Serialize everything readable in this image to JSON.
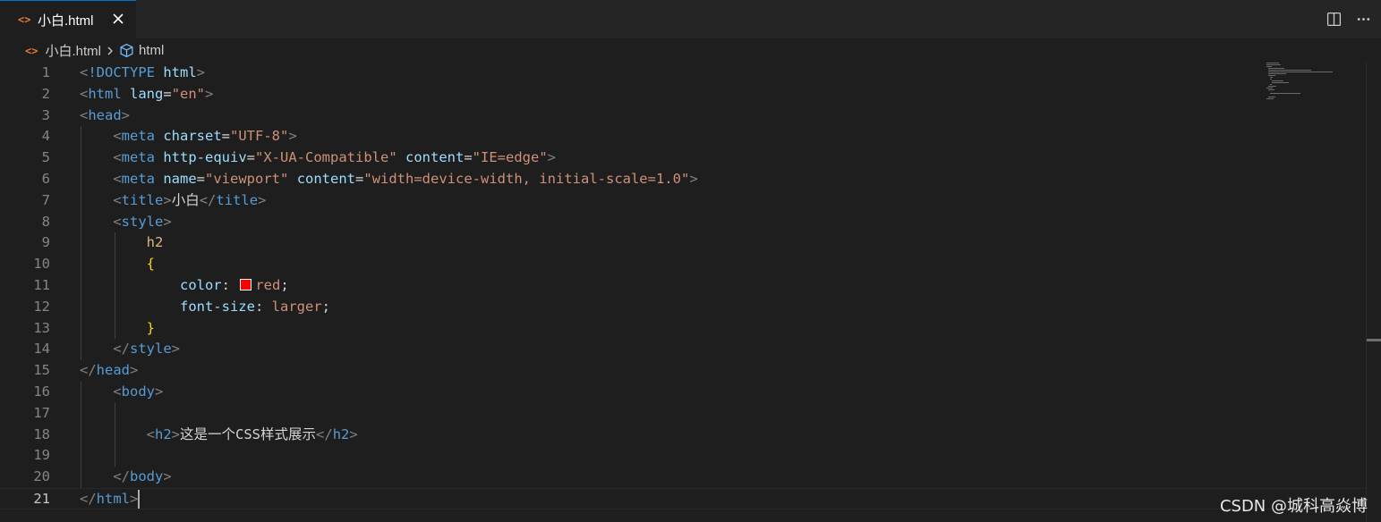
{
  "tab": {
    "label": "小白.html",
    "icon": "html-icon"
  },
  "breadcrumb": {
    "file": "小白.html",
    "symbol": "html"
  },
  "editor": {
    "active_line": 21,
    "lines": [
      {
        "n": "1",
        "tokens": [
          [
            "t-punct",
            "<"
          ],
          [
            "t-doctype",
            "!DOCTYPE"
          ],
          [
            "t-text",
            " "
          ],
          [
            "t-attr",
            "html"
          ],
          [
            "t-punct",
            ">"
          ]
        ]
      },
      {
        "n": "2",
        "tokens": [
          [
            "t-punct",
            "<"
          ],
          [
            "t-tag",
            "html"
          ],
          [
            "t-text",
            " "
          ],
          [
            "t-attr",
            "lang"
          ],
          [
            "t-text",
            "="
          ],
          [
            "t-str",
            "\"en\""
          ],
          [
            "t-punct",
            ">"
          ]
        ]
      },
      {
        "n": "3",
        "tokens": [
          [
            "t-punct",
            "<"
          ],
          [
            "t-tag",
            "head"
          ],
          [
            "t-punct",
            ">"
          ]
        ]
      },
      {
        "n": "4",
        "tokens": [
          [
            "t-text",
            "    "
          ],
          [
            "t-punct",
            "<"
          ],
          [
            "t-tag",
            "meta"
          ],
          [
            "t-text",
            " "
          ],
          [
            "t-attr",
            "charset"
          ],
          [
            "t-text",
            "="
          ],
          [
            "t-str",
            "\"UTF-8\""
          ],
          [
            "t-punct",
            ">"
          ]
        ]
      },
      {
        "n": "5",
        "tokens": [
          [
            "t-text",
            "    "
          ],
          [
            "t-punct",
            "<"
          ],
          [
            "t-tag",
            "meta"
          ],
          [
            "t-text",
            " "
          ],
          [
            "t-attr",
            "http-equiv"
          ],
          [
            "t-text",
            "="
          ],
          [
            "t-str",
            "\"X-UA-Compatible\""
          ],
          [
            "t-text",
            " "
          ],
          [
            "t-attr",
            "content"
          ],
          [
            "t-text",
            "="
          ],
          [
            "t-str",
            "\"IE=edge\""
          ],
          [
            "t-punct",
            ">"
          ]
        ]
      },
      {
        "n": "6",
        "tokens": [
          [
            "t-text",
            "    "
          ],
          [
            "t-punct",
            "<"
          ],
          [
            "t-tag",
            "meta"
          ],
          [
            "t-text",
            " "
          ],
          [
            "t-attr",
            "name"
          ],
          [
            "t-text",
            "="
          ],
          [
            "t-str",
            "\"viewport\""
          ],
          [
            "t-text",
            " "
          ],
          [
            "t-attr",
            "content"
          ],
          [
            "t-text",
            "="
          ],
          [
            "t-str",
            "\"width=device-width, initial-scale=1.0\""
          ],
          [
            "t-punct",
            ">"
          ]
        ]
      },
      {
        "n": "7",
        "tokens": [
          [
            "t-text",
            "    "
          ],
          [
            "t-punct",
            "<"
          ],
          [
            "t-tag",
            "title"
          ],
          [
            "t-punct",
            ">"
          ],
          [
            "t-text",
            "小白"
          ],
          [
            "t-punct",
            "</"
          ],
          [
            "t-tag",
            "title"
          ],
          [
            "t-punct",
            ">"
          ]
        ]
      },
      {
        "n": "8",
        "tokens": [
          [
            "t-text",
            "    "
          ],
          [
            "t-punct",
            "<"
          ],
          [
            "t-tag",
            "style"
          ],
          [
            "t-punct",
            ">"
          ]
        ]
      },
      {
        "n": "9",
        "tokens": [
          [
            "t-text",
            "        "
          ],
          [
            "t-sel",
            "h2"
          ]
        ]
      },
      {
        "n": "10",
        "tokens": [
          [
            "t-text",
            "        "
          ],
          [
            "t-brace",
            "{"
          ]
        ]
      },
      {
        "n": "11",
        "tokens": [
          [
            "t-text",
            "            "
          ],
          [
            "t-prop",
            "color"
          ],
          [
            "t-text",
            ": "
          ],
          [
            "swatch",
            ""
          ],
          [
            "t-val",
            "red"
          ],
          [
            "t-text",
            ";"
          ]
        ]
      },
      {
        "n": "12",
        "tokens": [
          [
            "t-text",
            "            "
          ],
          [
            "t-prop",
            "font-size"
          ],
          [
            "t-text",
            ": "
          ],
          [
            "t-val",
            "larger"
          ],
          [
            "t-text",
            ";"
          ]
        ]
      },
      {
        "n": "13",
        "tokens": [
          [
            "t-text",
            "        "
          ],
          [
            "t-brace",
            "}"
          ]
        ]
      },
      {
        "n": "14",
        "tokens": [
          [
            "t-text",
            "    "
          ],
          [
            "t-punct",
            "</"
          ],
          [
            "t-tag",
            "style"
          ],
          [
            "t-punct",
            ">"
          ]
        ]
      },
      {
        "n": "15",
        "tokens": [
          [
            "t-punct",
            "</"
          ],
          [
            "t-tag",
            "head"
          ],
          [
            "t-punct",
            ">"
          ]
        ]
      },
      {
        "n": "16",
        "tokens": [
          [
            "t-text",
            "    "
          ],
          [
            "t-punct",
            "<"
          ],
          [
            "t-tag",
            "body"
          ],
          [
            "t-punct",
            ">"
          ]
        ]
      },
      {
        "n": "17",
        "tokens": []
      },
      {
        "n": "18",
        "tokens": [
          [
            "t-text",
            "        "
          ],
          [
            "t-punct",
            "<"
          ],
          [
            "t-tag",
            "h2"
          ],
          [
            "t-punct",
            ">"
          ],
          [
            "t-text",
            "这是一个CSS样式展示"
          ],
          [
            "t-punct",
            "</"
          ],
          [
            "t-tag",
            "h2"
          ],
          [
            "t-punct",
            ">"
          ]
        ]
      },
      {
        "n": "19",
        "tokens": []
      },
      {
        "n": "20",
        "tokens": [
          [
            "t-text",
            "    "
          ],
          [
            "t-punct",
            "</"
          ],
          [
            "t-tag",
            "body"
          ],
          [
            "t-punct",
            ">"
          ]
        ]
      },
      {
        "n": "21",
        "tokens": [
          [
            "t-punct",
            "</"
          ],
          [
            "t-tag",
            "html"
          ],
          [
            "t-punct",
            ">"
          ],
          [
            "cursor",
            ""
          ]
        ]
      }
    ]
  },
  "watermark": "CSDN @城科高焱博",
  "colors": {
    "accent": "#0078d4",
    "html_icon": "#e37933",
    "color_swatch": "#ff0000"
  }
}
